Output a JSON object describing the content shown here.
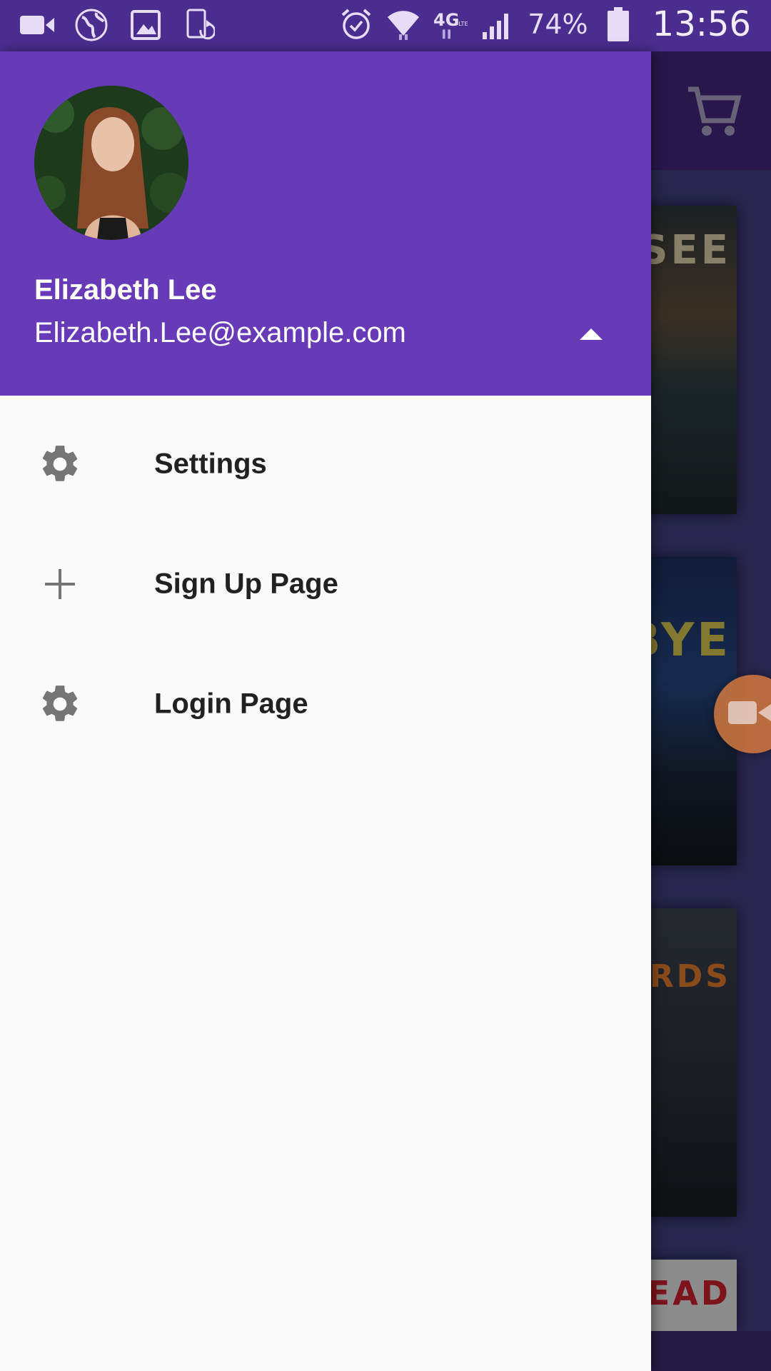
{
  "status_bar": {
    "left_icons": [
      "video-camera-icon",
      "globe-icon",
      "image-icon",
      "screen-rotate-icon"
    ],
    "right_icons": [
      "alarm-icon",
      "wifi-icon",
      "4g-lte-icon",
      "signal-icon"
    ],
    "battery_percent": "74%",
    "time": "13:56"
  },
  "app": {
    "toolbar_icon": "shopping-cart-icon",
    "books": [
      {
        "cover_text": "AT NT SEE"
      },
      {
        "cover_text": "ST BYE"
      },
      {
        "cover_text": "RK RDS"
      },
      {
        "cover_text": "EAD"
      }
    ]
  },
  "drawer": {
    "header": {
      "account_name": "Elizabeth Lee",
      "account_email": "Elizabeth.Lee@example.com",
      "accent_color": "#673ab7",
      "toggle_icon": "arrow-drop-up-icon"
    },
    "items": [
      {
        "label": "Settings",
        "icon": "gear-icon"
      },
      {
        "label": "Sign Up Page",
        "icon": "plus-icon"
      },
      {
        "label": "Login Page",
        "icon": "gear-icon"
      }
    ]
  }
}
